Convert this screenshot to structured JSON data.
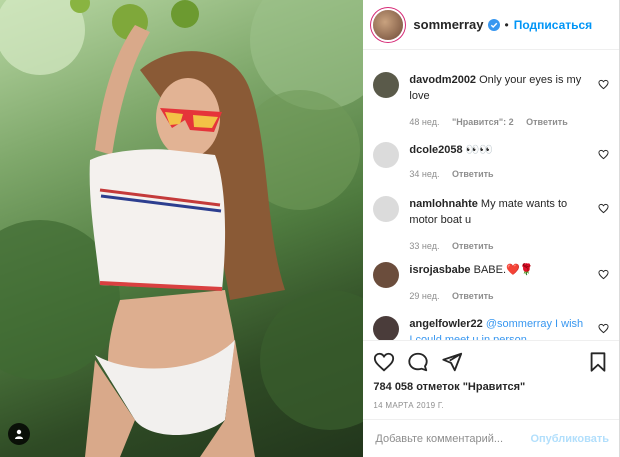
{
  "header": {
    "username": "sommerray",
    "separator": "•",
    "follow_label": "Подписаться"
  },
  "comments": [
    {
      "user": "davodm2002",
      "text": "Only your eyes is my love",
      "age": "48 нед.",
      "likes": "\"Нравится\": 2",
      "reply": "Ответить",
      "avatar_color": "#5a5a4a"
    },
    {
      "user": "dcole2058",
      "text": "👀👀",
      "age": "34 нед.",
      "likes": "",
      "reply": "Ответить",
      "avatar_color": "#dbdbdb"
    },
    {
      "user": "namlohnahte",
      "text": "My mate wants to motor boat u",
      "age": "33 нед.",
      "likes": "",
      "reply": "Ответить",
      "avatar_color": "#dbdbdb"
    },
    {
      "user": "isrojasbabe",
      "text": "BABE.❤️🌹",
      "age": "29 нед.",
      "likes": "",
      "reply": "Ответить",
      "avatar_color": "#6b4d3c"
    },
    {
      "user": "angelfowler22",
      "text": "@sommerray I wish I could meet u in person",
      "age": "",
      "likes": "",
      "reply": "",
      "avatar_color": "#4a3c3a"
    }
  ],
  "actions": {
    "likes_text": "784 058 отметок \"Нравится\"",
    "date": "14 марта 2019 г."
  },
  "add_comment": {
    "placeholder": "Добавьте комментарий...",
    "publish_label": "Опубликовать"
  },
  "colors": {
    "accent": "#0095f6",
    "accent_disabled": "#b2dffc",
    "meta_gray": "#8e8e8e"
  }
}
